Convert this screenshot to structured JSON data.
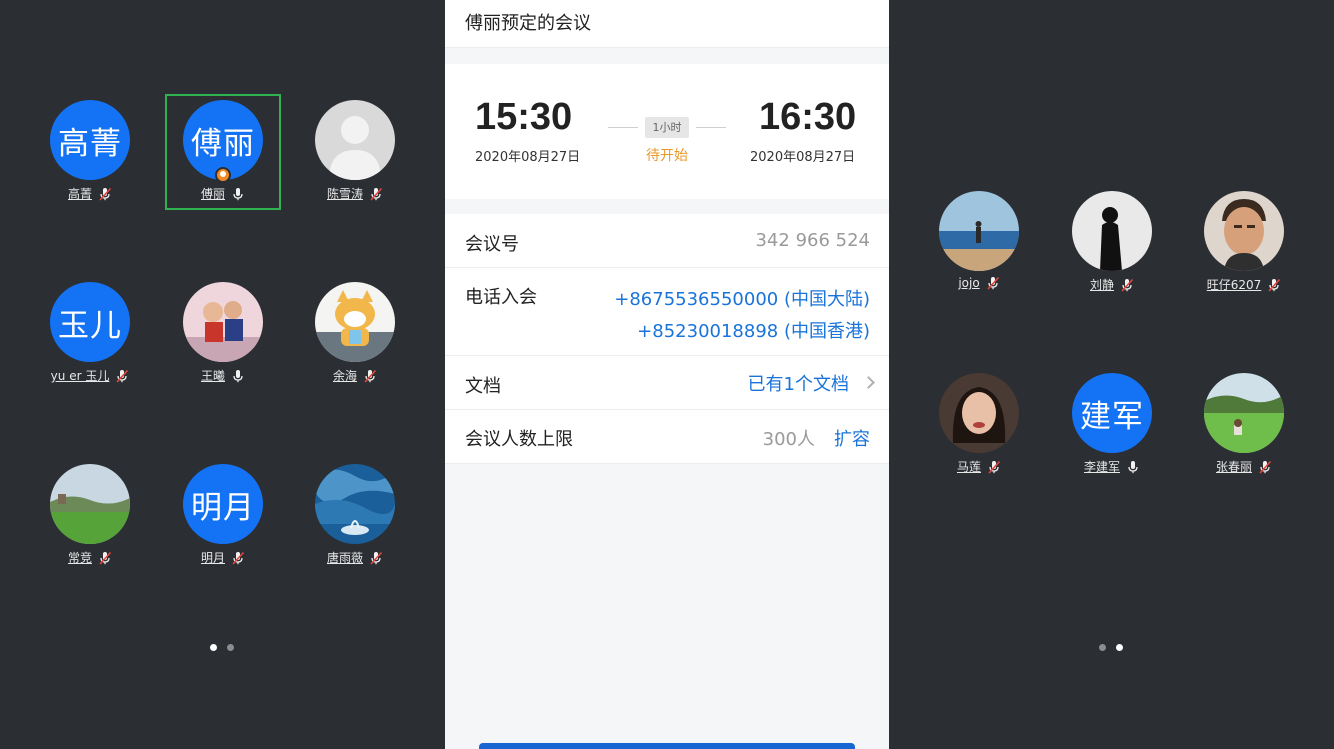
{
  "left_panel": {
    "participants": [
      {
        "name": "高菁",
        "avatar_text": "高菁",
        "mic": "muted"
      },
      {
        "name": "傅丽",
        "avatar_text": "傅丽",
        "mic": "on",
        "host": true,
        "selected": true
      },
      {
        "name": "陈雪涛",
        "avatar_photo": "default-person",
        "mic": "muted"
      },
      {
        "name": "yu er 玉儿",
        "avatar_text": "玉儿",
        "mic": "muted"
      },
      {
        "name": "王曦",
        "avatar_photo": "child-photo",
        "mic": "on"
      },
      {
        "name": "余海",
        "avatar_photo": "cartoon-dog",
        "mic": "muted"
      },
      {
        "name": "常竞",
        "avatar_photo": "field-landscape",
        "mic": "muted"
      },
      {
        "name": "明月",
        "avatar_text": "明月",
        "mic": "muted"
      },
      {
        "name": "唐雨薇",
        "avatar_photo": "blue-water-art",
        "mic": "muted"
      }
    ],
    "page_dots": {
      "count": 2,
      "active": 1
    }
  },
  "meeting": {
    "title": "傅丽预定的会议",
    "start_time": "15:30",
    "start_date": "2020年08月27日",
    "end_time": "16:30",
    "end_date": "2020年08月27日",
    "duration": "1小时",
    "status": "待开始",
    "rows": {
      "meeting_id_label": "会议号",
      "meeting_id": "342 966 524",
      "phone_label": "电话入会",
      "phone_1": "+8675536550000 (中国大陆)",
      "phone_2": "+85230018898 (中国香港)",
      "docs_label": "文档",
      "docs_value": "已有1个文档",
      "limit_label": "会议人数上限",
      "limit_value": "300人",
      "expand_label": "扩容"
    },
    "accent_color": "#1a73d9",
    "status_color": "#e79a2a"
  },
  "right_panel": {
    "participants": [
      {
        "name": "jojo",
        "avatar_photo": "beach-photo",
        "mic": "muted"
      },
      {
        "name": "刘静",
        "avatar_photo": "silhouette",
        "mic": "muted"
      },
      {
        "name": "旺仔6207",
        "avatar_photo": "man-portrait",
        "mic": "muted"
      },
      {
        "name": "马莲",
        "avatar_photo": "woman-portrait",
        "mic": "muted"
      },
      {
        "name": "李建军",
        "avatar_text": "建军",
        "mic": "on"
      },
      {
        "name": "张春丽",
        "avatar_photo": "grass-photo",
        "mic": "muted"
      }
    ],
    "page_dots": {
      "count": 2,
      "active": 2
    }
  },
  "colors": {
    "panel_bg": "#2b2e33",
    "avatar_blue": "#1473f5",
    "selection_green": "#2fb24f"
  }
}
